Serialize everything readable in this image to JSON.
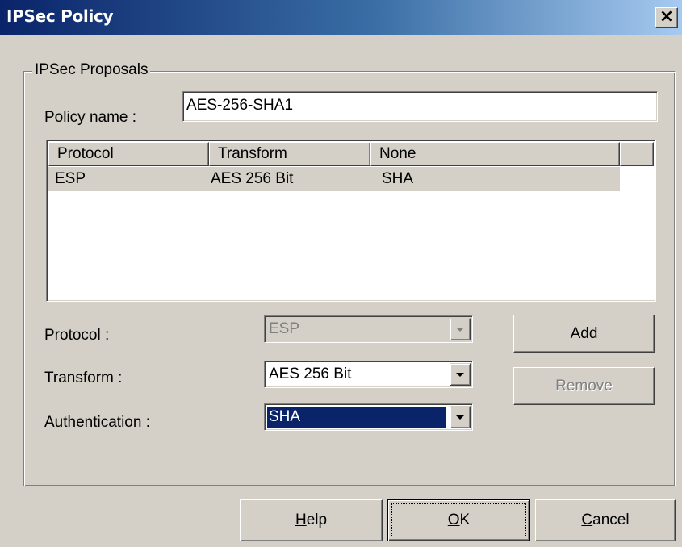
{
  "window": {
    "title": "IPSec Policy",
    "close_glyph": "×"
  },
  "group": {
    "legend": "IPSec Proposals"
  },
  "policy": {
    "label": "Policy name :",
    "value": "AES-256-SHA1"
  },
  "list": {
    "columns": [
      "Protocol",
      "Transform",
      "None"
    ],
    "rows": [
      {
        "protocol": "ESP",
        "transform": "AES 256 Bit",
        "auth": "SHA"
      }
    ]
  },
  "form": {
    "protocol_label": "Protocol :",
    "protocol_value": "ESP",
    "transform_label": "Transform :",
    "transform_value": "AES 256 Bit",
    "auth_label": "Authentication :",
    "auth_value": "SHA"
  },
  "buttons": {
    "add": "Add",
    "remove": "Remove",
    "help_first": "H",
    "help_rest": "elp",
    "ok_first": "O",
    "ok_rest": "K",
    "cancel_first": "C",
    "cancel_rest": "ancel"
  },
  "icons": {
    "close": "close-icon",
    "dropdown": "chevron-down-icon"
  },
  "colors": {
    "title_start": "#0a246a",
    "title_end": "#a6caf0",
    "face": "#d4d0c8",
    "selection": "#0a246a"
  }
}
